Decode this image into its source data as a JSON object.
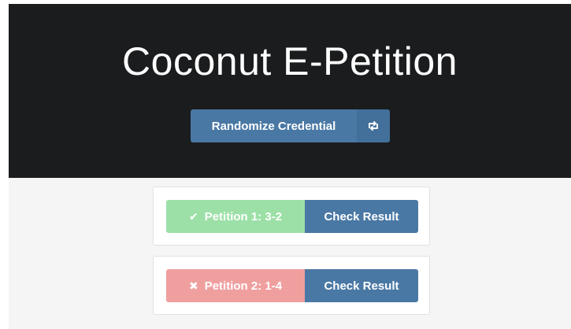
{
  "header": {
    "title": "Coconut E-Petition",
    "randomize_label": "Randomize Credential",
    "randomize_icon": "retweet-icon"
  },
  "petitions": [
    {
      "status_icon": "check-icon",
      "status_symbol": "✔",
      "label": "Petition 1: 3-2",
      "state": "success",
      "state_color": "#9ce0a7",
      "button_label": "Check Result"
    },
    {
      "status_icon": "times-icon",
      "status_symbol": "✖",
      "label": "Petition 2: 1-4",
      "state": "failure",
      "state_color": "#f09f9f",
      "button_label": "Check Result"
    }
  ],
  "colors": {
    "hero_bg": "#1b1c1e",
    "accent_blue": "#4a78a4",
    "content_bg": "#f5f5f5"
  }
}
